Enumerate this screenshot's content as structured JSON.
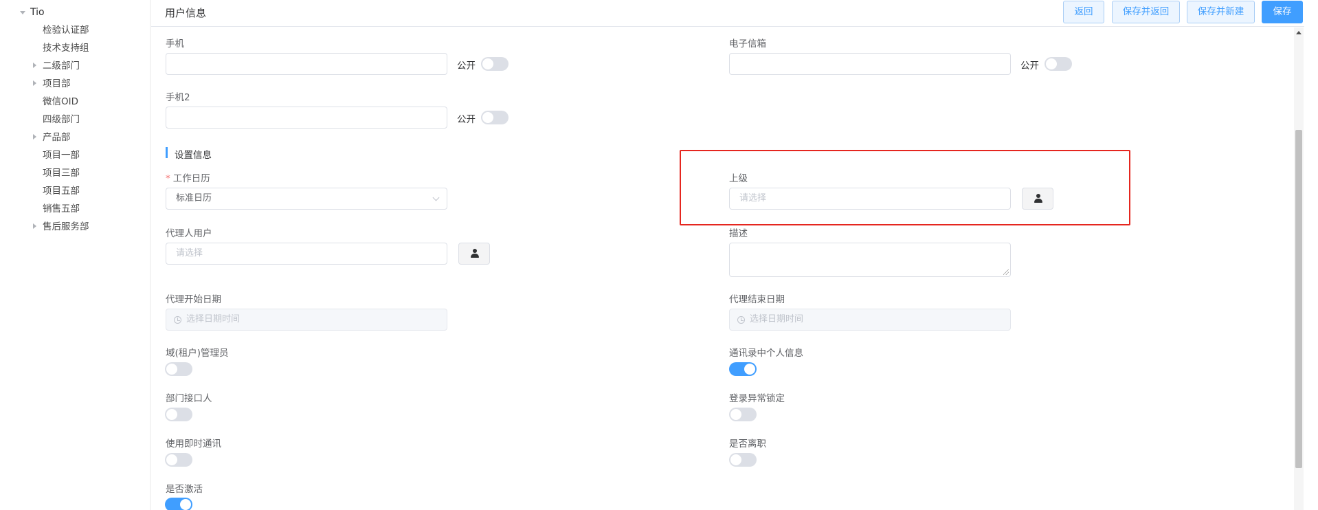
{
  "sidebar": {
    "root": "Tio",
    "items": [
      {
        "label": "检验认证部",
        "expandable": false
      },
      {
        "label": "技术支持组",
        "expandable": false
      },
      {
        "label": "二级部门",
        "expandable": true
      },
      {
        "label": "项目部",
        "expandable": true
      },
      {
        "label": "微信OID",
        "expandable": false
      },
      {
        "label": "四级部门",
        "expandable": false
      },
      {
        "label": "产品部",
        "expandable": true
      },
      {
        "label": "项目一部",
        "expandable": false
      },
      {
        "label": "项目三部",
        "expandable": false
      },
      {
        "label": "项目五部",
        "expandable": false
      },
      {
        "label": "销售五部",
        "expandable": false
      },
      {
        "label": "售后服务部",
        "expandable": true
      }
    ]
  },
  "header": {
    "title": "用户信息",
    "buttons": {
      "back": "返回",
      "save_and_back": "保存并返回",
      "save_and_new": "保存并新建",
      "save": "保存"
    }
  },
  "contact": {
    "public_label": "公开",
    "phone": {
      "label": "手机",
      "value": "",
      "public": false
    },
    "email": {
      "label": "电子信箱",
      "value": "",
      "public": false
    },
    "phone2": {
      "label": "手机2",
      "value": "",
      "public": false
    }
  },
  "settings": {
    "section_title": "设置信息",
    "work_calendar": {
      "required_mark": "*",
      "label": "工作日历",
      "value": "标准日历"
    },
    "superior": {
      "label": "上级",
      "placeholder": "请选择"
    },
    "proxy_user": {
      "label": "代理人用户",
      "placeholder": "请选择"
    },
    "description": {
      "label": "描述",
      "value": ""
    },
    "proxy_start": {
      "label": "代理开始日期",
      "placeholder": "选择日期时间"
    },
    "proxy_end": {
      "label": "代理结束日期",
      "placeholder": "选择日期时间"
    },
    "toggles": {
      "domain_admin": {
        "label": "域(租户)管理员",
        "on": false
      },
      "address_book_info": {
        "label": "通讯录中个人信息",
        "on": true
      },
      "dept_contact": {
        "label": "部门接口人",
        "on": false
      },
      "login_lock": {
        "label": "登录异常锁定",
        "on": false
      },
      "instant_messaging": {
        "label": "使用即时通讯",
        "on": false
      },
      "resigned": {
        "label": "是否离职",
        "on": false
      },
      "activated": {
        "label": "是否激活",
        "on": true
      }
    }
  },
  "colors": {
    "accent": "#409eff",
    "highlight": "#e5261f",
    "toggle_off": "#dcdfe6"
  }
}
